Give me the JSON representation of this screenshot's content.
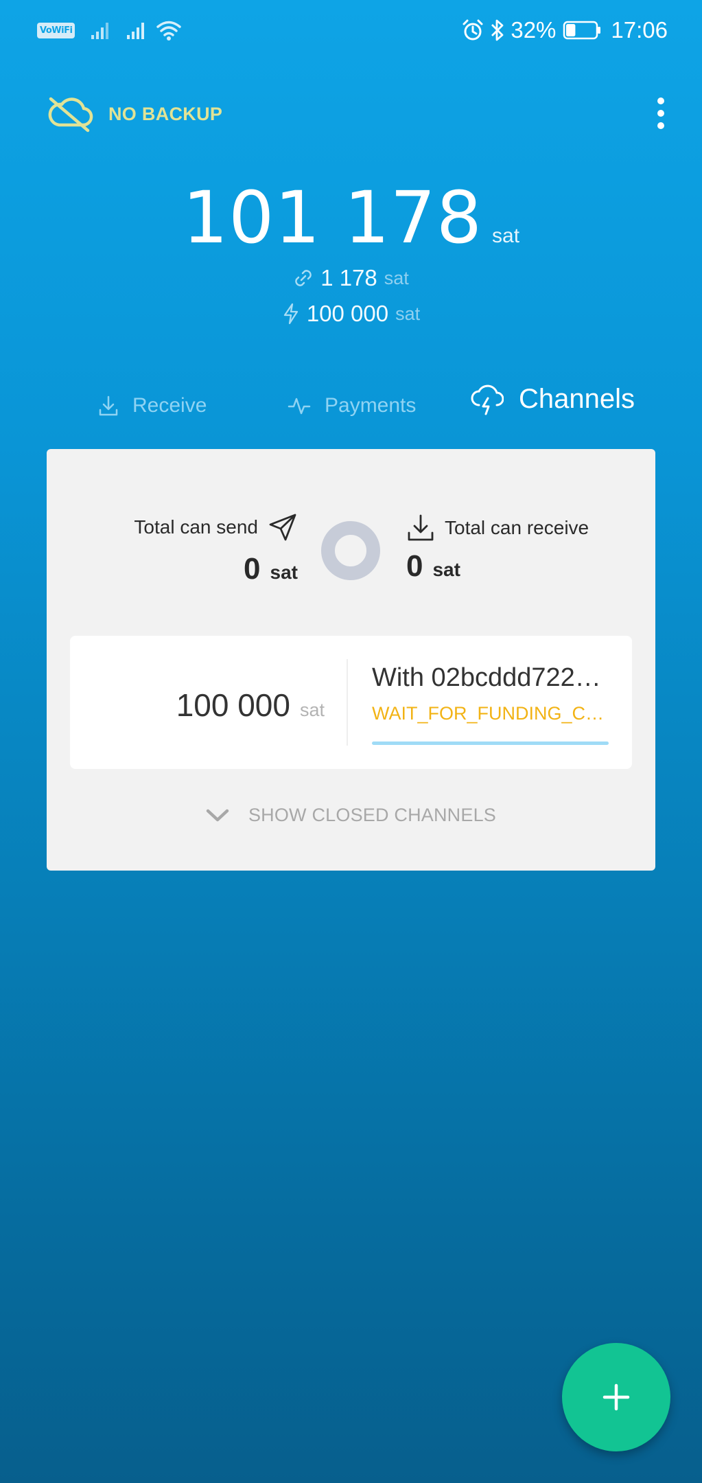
{
  "status_bar": {
    "network_label": "VoWiFi",
    "battery": "32%",
    "time": "17:06",
    "battery_level": 0.32,
    "icons": [
      "vowifi-icon",
      "signal-icon",
      "signal-icon",
      "wifi-icon",
      "alarm-icon",
      "bluetooth-icon",
      "battery-icon"
    ]
  },
  "header": {
    "backup_label": "NO BACKUP",
    "backup_icon": "cloud-off-icon",
    "menu_icon": "more-vert-icon"
  },
  "balance": {
    "total": "101 178",
    "total_unit": "sat",
    "onchain": "1 178",
    "onchain_unit": "sat",
    "lightning": "100 000",
    "lightning_unit": "sat"
  },
  "tabs": [
    {
      "label": "Receive",
      "icon": "download-icon",
      "active": false
    },
    {
      "label": "Payments",
      "icon": "activity-icon",
      "active": false
    },
    {
      "label": "Channels",
      "icon": "cloud-lightning-icon",
      "active": true
    }
  ],
  "channels_card": {
    "send_label": "Total can send",
    "send_value": "0",
    "send_unit": "sat",
    "receive_label": "Total can receive",
    "receive_value": "0",
    "receive_unit": "sat",
    "channels": [
      {
        "amount": "100 000",
        "unit": "sat",
        "peer": "With 02bcddd722…",
        "state": "WAIT_FOR_FUNDING_CO…",
        "progress": 1.0
      }
    ],
    "show_closed_label": "SHOW CLOSED CHANNELS"
  },
  "fab": {
    "icon": "plus-icon"
  },
  "colors": {
    "background_top": "#0ea4e6",
    "background_bottom": "#075f8d",
    "backup_warning": "#e1e396",
    "channel_state": "#f2b315",
    "fab": "#12c493",
    "progress": "#9fdbf6"
  }
}
